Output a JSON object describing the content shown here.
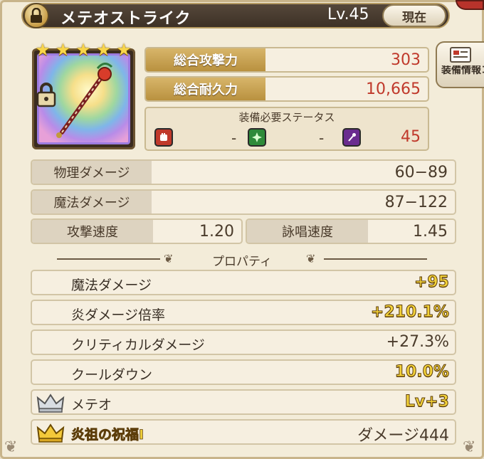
{
  "header": {
    "title": "メテオストライク",
    "level": "Lv.45",
    "current_button": "現在"
  },
  "item": {
    "star_count": 5,
    "locked": true
  },
  "stats": {
    "total_attack_label": "総合攻撃力",
    "total_attack_value": "303",
    "total_durability_label": "総合耐久力",
    "total_durability_value": "10,665"
  },
  "requirements": {
    "title": "装備必要ステータス",
    "strength_value": "-",
    "dexterity_value": "-",
    "magic_value": "45"
  },
  "copy_button": {
    "label": "装備情報コピー"
  },
  "damage": {
    "physical_label": "物理ダメージ",
    "physical_value": "60−89",
    "magic_label": "魔法ダメージ",
    "magic_value": "87−122",
    "attack_speed_label": "攻撃速度",
    "attack_speed_value": "1.20",
    "cast_speed_label": "詠唱速度",
    "cast_speed_value": "1.45"
  },
  "properties": {
    "title": "プロパティ",
    "rows": [
      {
        "label": "魔法ダメージ",
        "value": "+95"
      },
      {
        "label": "炎ダメージ倍率",
        "value": "+210.1%"
      },
      {
        "label": "クリティカルダメージ",
        "value": "+27.3%"
      },
      {
        "label": "クールダウン",
        "value": "10.0%"
      },
      {
        "label": "メテオ",
        "value": "Lv+3"
      },
      {
        "label": "炎祖の祝福Ⅰ",
        "value": "ダメージ444"
      }
    ]
  },
  "colors": {
    "accent_red": "#c0392b",
    "gold_text": "#f3d23a",
    "header_bg": "#3d3126"
  }
}
